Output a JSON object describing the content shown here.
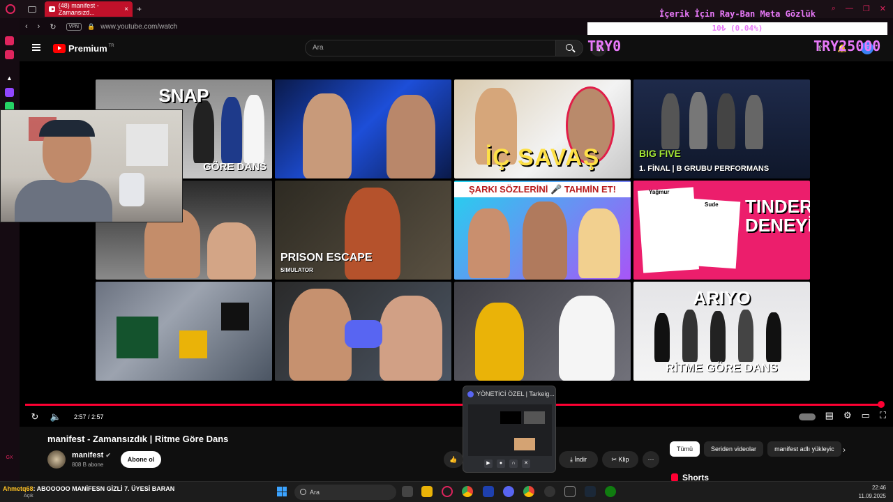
{
  "browser": {
    "tab_title": "(48) manifest - Zamansızd...",
    "url": "www.youtube.com/watch",
    "vpn_label": "VPN"
  },
  "youtube": {
    "logo_text": "Premium",
    "logo_sup": "TR",
    "search_placeholder": "Ara"
  },
  "overlay": {
    "promo_text": "İçerik İçin Ray-Ban Meta Gözlük",
    "progress_text": "10₺ (0.04%)",
    "progress_fraction": 0.0004,
    "try_left": "TRY0",
    "try_right": "TRY25000"
  },
  "thumbnails": [
    {
      "caption": "SNAP",
      "subcaption": "GÖRE DANS"
    },
    {
      "caption": ""
    },
    {
      "caption": "İÇ SAVAŞ"
    },
    {
      "caption": "BIG FIVE",
      "subcaption": "1. FİNAL | B GRUBU PERFORMANS"
    },
    {
      "caption": ""
    },
    {
      "caption": "PRISON ESCAPE",
      "subcaption": "SIMULATOR"
    },
    {
      "caption": "ŞARKI SÖZLERİNİ 🎤 TAHMİN ET!"
    },
    {
      "caption": "TINDER DENEYİ",
      "name1": "Yağmur",
      "name2": "Sude"
    },
    {
      "caption": ""
    },
    {
      "caption": ""
    },
    {
      "caption": ""
    },
    {
      "caption": "ARIYO",
      "subcaption": "RİTME GÖRE DANS"
    }
  ],
  "player": {
    "time": "2:57 / 2:57",
    "progress": 1.0
  },
  "discord_popup": {
    "title": "YÖNETİCİ ÖZEL | Tarkeig..."
  },
  "video": {
    "title": "manifest - Zamansızdık | Ritme Göre Dans",
    "channel": "manifest",
    "subscribers": "808 B abone",
    "subscribe_label": "Abone ol",
    "download_label": "İndir",
    "clip_label": "Klip"
  },
  "chips": [
    "Tümü",
    "Seriden videolar",
    "manifest adlı yükleyic"
  ],
  "shorts_label": "Shorts",
  "taskbar": {
    "chat_user": "Ahmetq68",
    "chat_text": ": ABOOOOO MANİFESN GİZLİ 7. ÜYESİ BARAN",
    "status": "Açık",
    "search": "Ara",
    "time": "22:46",
    "date": "11.09.2025"
  }
}
